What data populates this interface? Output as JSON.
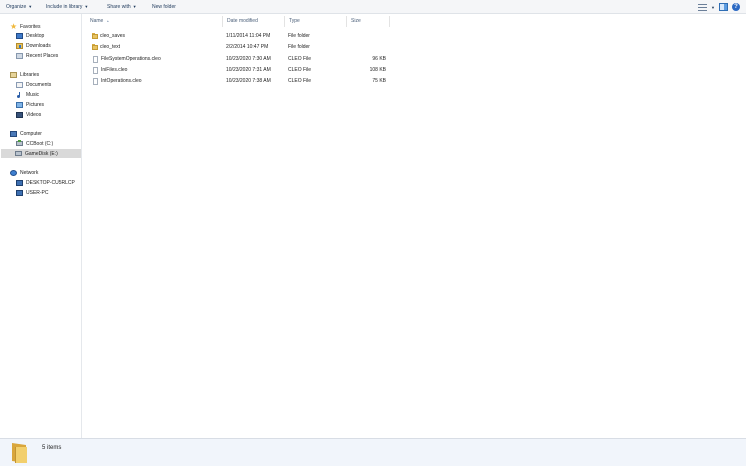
{
  "toolbar": {
    "organize": "Organize",
    "include_in_library": "Include in library",
    "share_with": "Share with",
    "new_folder": "New folder"
  },
  "nav": {
    "favorites": "Favorites",
    "desktop": "Desktop",
    "downloads": "Downloads",
    "recent_places": "Recent Places",
    "libraries": "Libraries",
    "documents": "Documents",
    "music": "Music",
    "pictures": "Pictures",
    "videos": "Videos",
    "computer": "Computer",
    "ccboot": "CCBoot (C:)",
    "gamedisk": "GameDisk (E:)",
    "network": "Network",
    "desktop_pc": "DESKTOP-CU5RLCP",
    "user_pc": "USER-PC"
  },
  "columns": {
    "name": "Name",
    "date_modified": "Date modified",
    "type": "Type",
    "size": "Size"
  },
  "files": [
    {
      "name": "cleo_saves",
      "date": "1/11/2014 11:04 PM",
      "type": "File folder",
      "size": "",
      "icon": "folder-icon"
    },
    {
      "name": "cleo_text",
      "date": "2/2/2014 10:47 PM",
      "type": "File folder",
      "size": "",
      "icon": "folder-icon"
    },
    {
      "name": "FileSystemOperations.cleo",
      "date": "10/23/2020 7:30 AM",
      "type": "CLEO File",
      "size": "96 KB",
      "icon": "file-icon"
    },
    {
      "name": "IniFiles.cleo",
      "date": "10/23/2020 7:31 AM",
      "type": "CLEO File",
      "size": "108 KB",
      "icon": "file-icon"
    },
    {
      "name": "IntOperations.cleo",
      "date": "10/23/2020 7:38 AM",
      "type": "CLEO File",
      "size": "75 KB",
      "icon": "file-icon"
    }
  ],
  "status": {
    "item_count": "5 items"
  }
}
